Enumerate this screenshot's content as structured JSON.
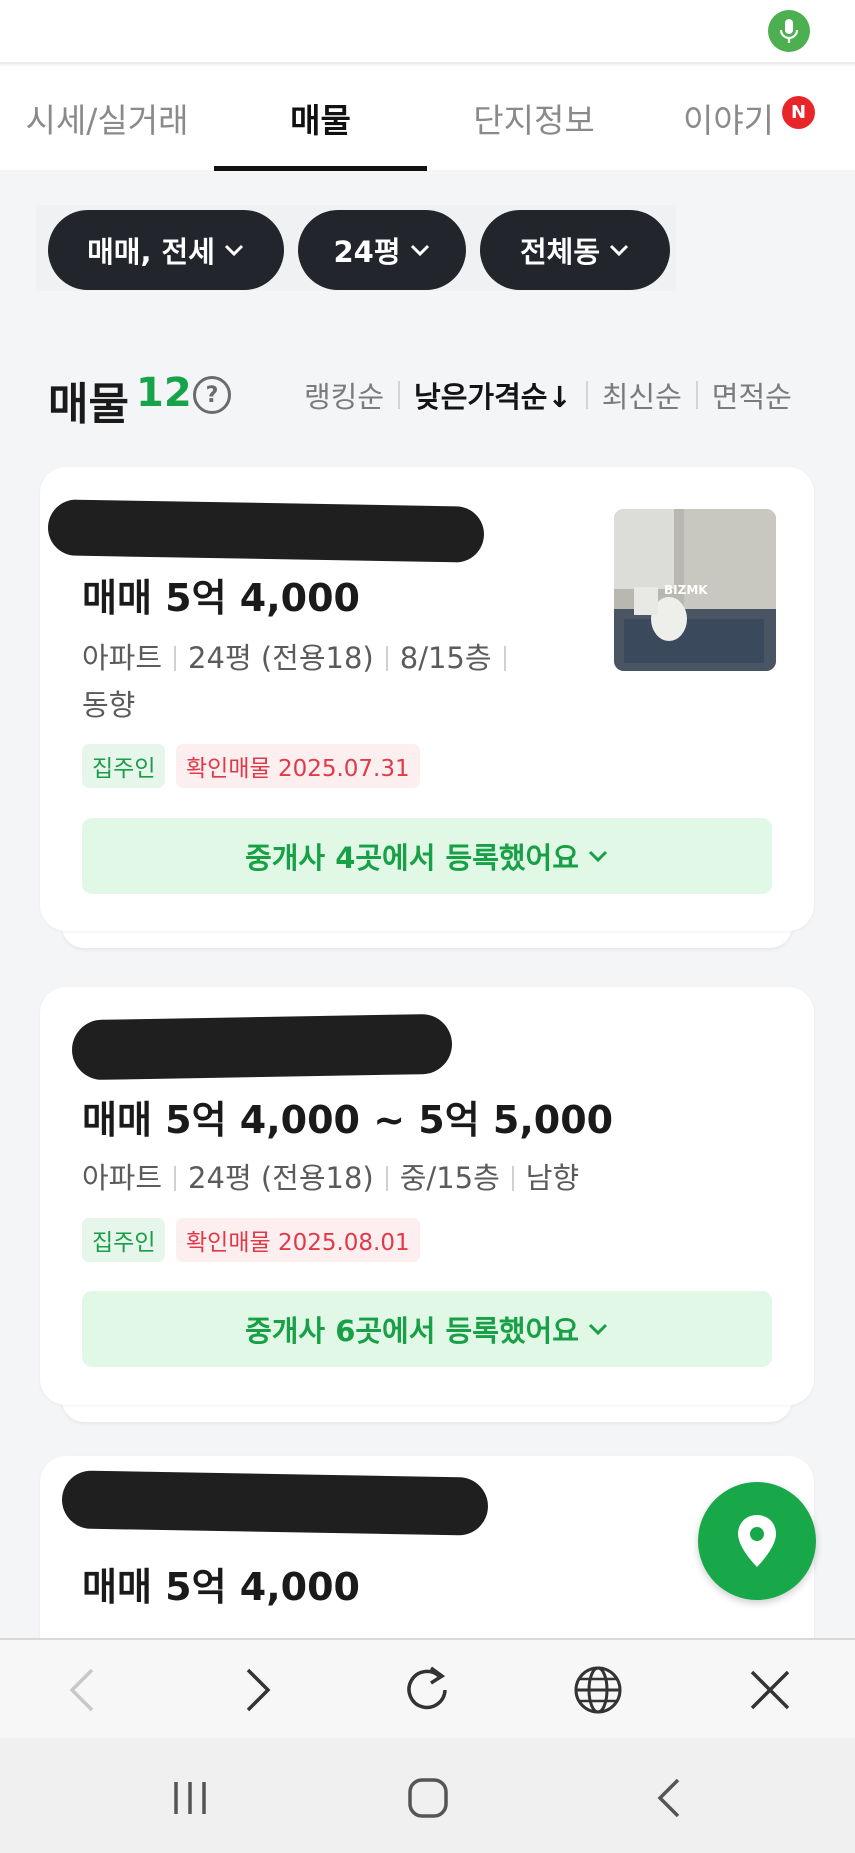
{
  "tabs": [
    {
      "label": "시세/실거래"
    },
    {
      "label": "매물"
    },
    {
      "label": "단지정보"
    },
    {
      "label": "이야기"
    }
  ],
  "tab_badge": "N",
  "filters": [
    {
      "label": "매매, 전세"
    },
    {
      "label": "24평"
    },
    {
      "label": "전체동"
    }
  ],
  "list": {
    "title": "매물",
    "count": "12",
    "sort_options": [
      "랭킹순",
      "낮은가격순↓",
      "최신순",
      "면적순"
    ],
    "active_sort": "낮은가격순↓"
  },
  "listings": [
    {
      "price": "매매 5억 4,000",
      "info": [
        "아파트",
        "24평 (전용18)",
        "8/15층"
      ],
      "info_line2": "동향",
      "tag_owner": "집주인",
      "tag_verified": "확인매물 2025.07.31",
      "agent_text": "중개사 4곳에서 등록했어요",
      "has_photo": true
    },
    {
      "price": "매매 5억 4,000 ~ 5억 5,000",
      "info": [
        "아파트",
        "24평 (전용18)",
        "중/15층",
        "남향"
      ],
      "tag_owner": "집주인",
      "tag_verified": "확인매물 2025.08.01",
      "agent_text": "중개사 6곳에서 등록했어요",
      "has_photo": false
    },
    {
      "price": "매매 5억 4,000"
    }
  ],
  "photo_watermark": "BIZMK",
  "colors": {
    "accent_green": "#18a84a",
    "chip_dark": "#22252b",
    "badge_red": "#e8262a",
    "tag_red_text": "#e03a48"
  },
  "icons": [
    "mic-icon",
    "chevron-down-icon",
    "help-icon",
    "location-pin-icon",
    "back-icon",
    "forward-icon",
    "refresh-icon",
    "globe-icon",
    "close-icon",
    "recent-apps-icon",
    "home-icon",
    "system-back-icon"
  ]
}
